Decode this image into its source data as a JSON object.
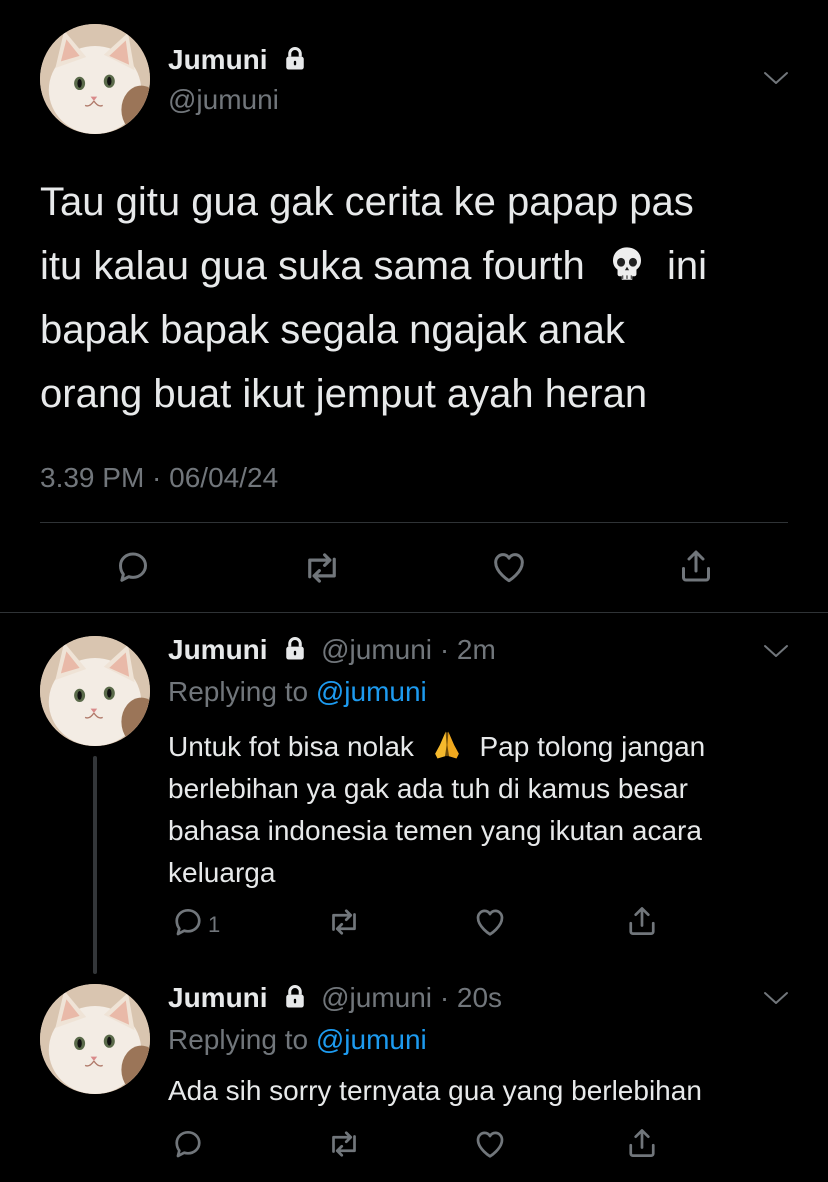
{
  "main_tweet": {
    "display_name": "Jumuni",
    "handle": "@jumuni",
    "text_lines": [
      "Tau gitu gua gak cerita ke papap pas",
      "itu kalau gua suka sama fourth",
      "ini",
      "bapak bapak segala ngajak anak",
      "orang buat ikut jemput ayah heran"
    ],
    "timestamp": "3.39 PM · 06/04/24",
    "emoji": "skull"
  },
  "replies": [
    {
      "display_name": "Jumuni",
      "handle": "@jumuni",
      "time": "· 2m",
      "replying_prefix": "Replying to",
      "replying_to": "@jumuni",
      "text_lines": [
        "Untuk fot bisa nolak",
        "Pap tolong jangan",
        "berlebihan ya gak ada tuh di kamus besar",
        "bahasa indonesia temen yang ikutan acara",
        "keluarga"
      ],
      "emoji": "folded-hands",
      "reply_count": "1"
    },
    {
      "display_name": "Jumuni",
      "handle": "@jumuni",
      "time": "· 20s",
      "replying_prefix": "Replying to",
      "replying_to": "@jumuni",
      "text_lines": [
        "Ada sih sorry ternyata gua yang berlebihan"
      ]
    }
  ],
  "colors": {
    "background": "#000000",
    "text": "#e7e9ea",
    "muted": "#71767b",
    "link": "#1d9bf0",
    "divider": "#2f3336"
  },
  "icons": [
    "reply-icon",
    "retweet-icon",
    "like-icon",
    "share-icon",
    "lock-icon",
    "chevron-down-icon"
  ]
}
